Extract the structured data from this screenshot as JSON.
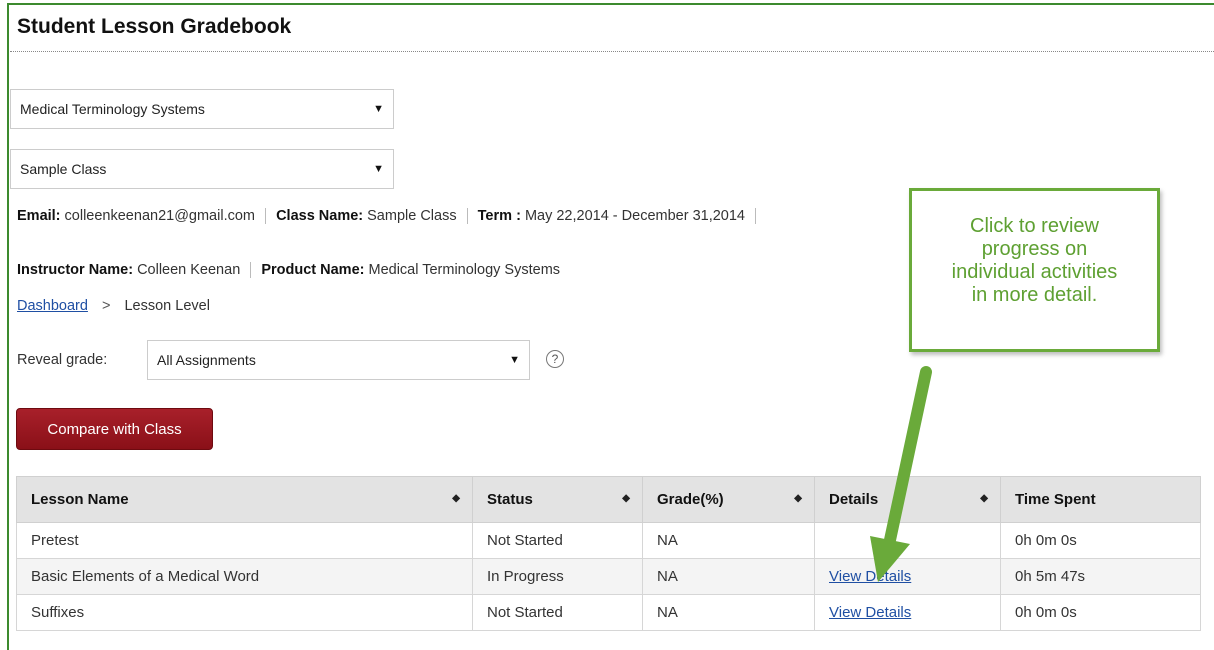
{
  "page": {
    "title": "Student Lesson Gradebook"
  },
  "selectors": {
    "product": "Medical Terminology Systems",
    "class": "Sample Class"
  },
  "info": {
    "email_label": "Email:",
    "email_value": "colleenkeenan21@gmail.com",
    "class_name_label": "Class Name:",
    "class_name_value": "Sample Class",
    "term_label": "Term :",
    "term_value": "May 22,2014 - December 31,2014",
    "instructor_label": "Instructor Name:",
    "instructor_value": "Colleen Keenan",
    "product_label": "Product Name:",
    "product_value": "Medical Terminology Systems"
  },
  "breadcrumb": {
    "link": "Dashboard",
    "separator": ">",
    "current": "Lesson Level"
  },
  "reveal": {
    "label": "Reveal grade:",
    "value": "All Assignments",
    "help": "?"
  },
  "compare_button": "Compare with Class",
  "table": {
    "headers": [
      "Lesson Name",
      "Status",
      "Grade(%)",
      "Details",
      "Time Spent"
    ],
    "rows": [
      {
        "lesson": "Pretest",
        "status": "Not Started",
        "grade": "NA",
        "details": "",
        "time": "0h 0m 0s"
      },
      {
        "lesson": "Basic Elements of a Medical Word",
        "status": "In Progress",
        "grade": "NA",
        "details": "View Details",
        "time": "0h 5m 47s"
      },
      {
        "lesson": "Suffixes",
        "status": "Not Started",
        "grade": "NA",
        "details": "View Details",
        "time": "0h 0m 0s"
      }
    ]
  },
  "callout": {
    "line1": "Click to review",
    "line2": "progress on",
    "line3": "individual activities",
    "line4": "in more detail."
  },
  "colors": {
    "accent_green": "#6aaa3a",
    "button_red": "#9a1820",
    "link_blue": "#1f4fa3"
  },
  "icons": {
    "dropdown": "caret-down-icon",
    "sort": "sort-icon",
    "help": "help-circle-icon"
  }
}
